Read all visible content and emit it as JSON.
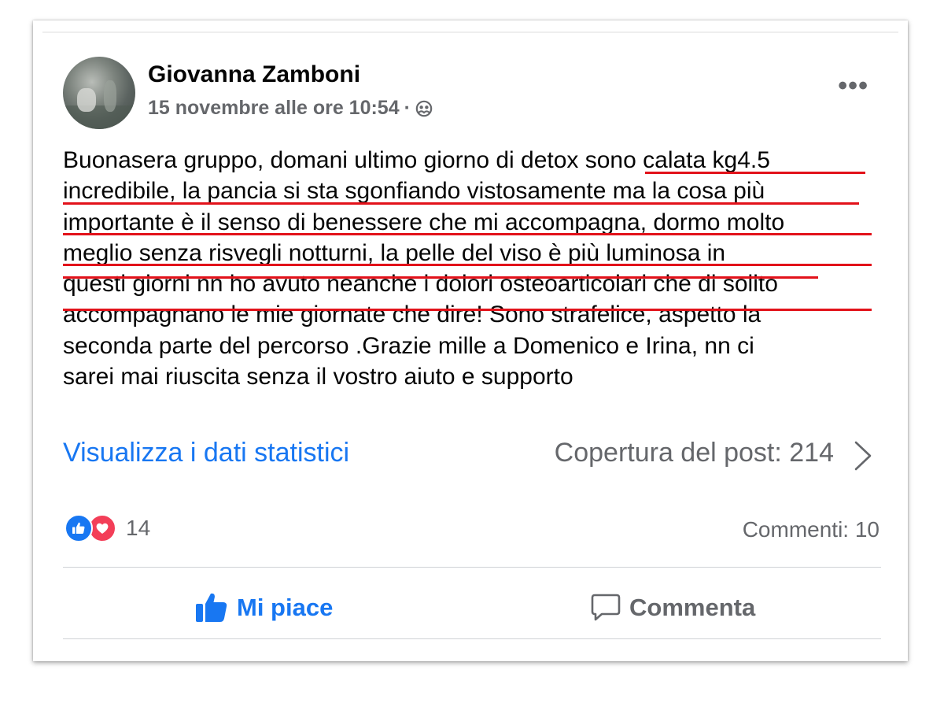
{
  "post": {
    "author": "Giovanna Zamboni",
    "timestamp": "15 novembre alle ore 10:54",
    "separator": "·",
    "audience_icon": "group-icon",
    "more_label": "•••",
    "text_lines": [
      "Buonasera gruppo, domani ultimo giorno di detox sono calata kg4.5",
      "incredibile, la pancia si sta sgonfiando vistosamente ma la cosa più",
      "importante è il senso di benessere che mi accompagna, dormo molto",
      "meglio senza risvegli notturni, la pelle del viso è più luminosa  in",
      "questi giorni nn ho avuto neanche i dolori osteoarticolari che di solito",
      "accompagnano le mie giornate che dire! Sono strafelice, aspetto la",
      "seconda parte del percorso .Grazie mille a Domenico e Irina, nn ci",
      "sarei mai riuscita senza il vostro aiuto e supporto"
    ]
  },
  "insights": {
    "link_label": "Visualizza i dati statistici",
    "reach_label": "Copertura del post: 214"
  },
  "engagement": {
    "reaction_count": "14",
    "comments_label": "Commenti: 10"
  },
  "actions": {
    "like_label": "Mi piace",
    "comment_label": "Commenta"
  },
  "colors": {
    "accent": "#1877f2",
    "love": "#f33e58",
    "underline": "#e2121a",
    "secondary_text": "#65676b"
  }
}
